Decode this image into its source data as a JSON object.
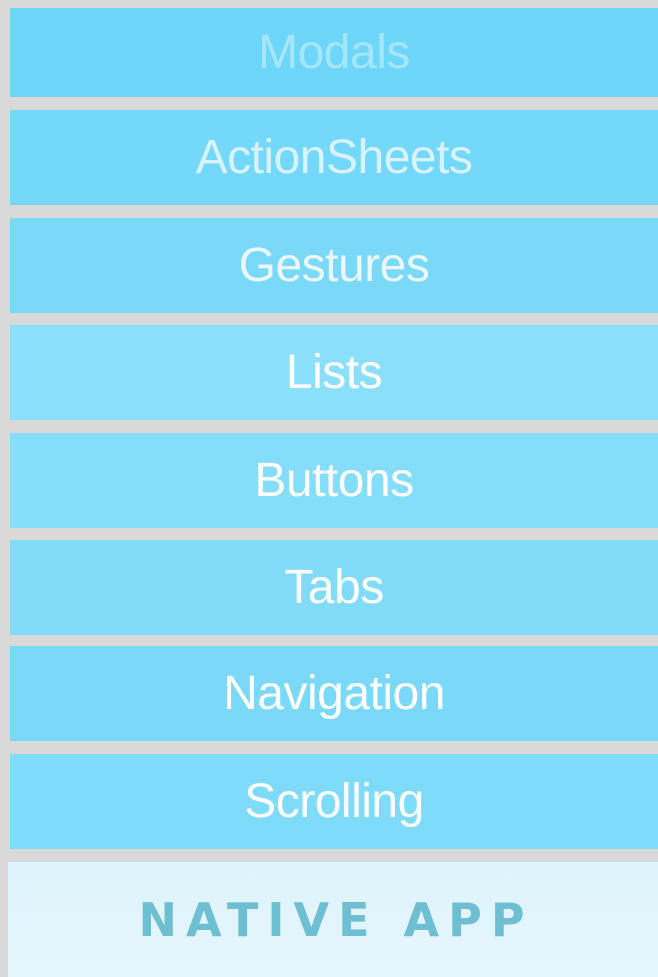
{
  "menu": {
    "items": [
      {
        "label": "Modals"
      },
      {
        "label": "ActionSheets"
      },
      {
        "label": "Gestures"
      },
      {
        "label": "Lists"
      },
      {
        "label": "Buttons"
      },
      {
        "label": "Tabs"
      },
      {
        "label": "Navigation"
      },
      {
        "label": "Scrolling"
      }
    ]
  },
  "footer": {
    "title": "NATIVE APP"
  },
  "colors": {
    "item_background": "#7fdbfa",
    "item_text": "#ffffff",
    "footer_background": "#e2f5fc",
    "footer_text": "#6fbfd2",
    "separator": "#d9d9d9"
  }
}
